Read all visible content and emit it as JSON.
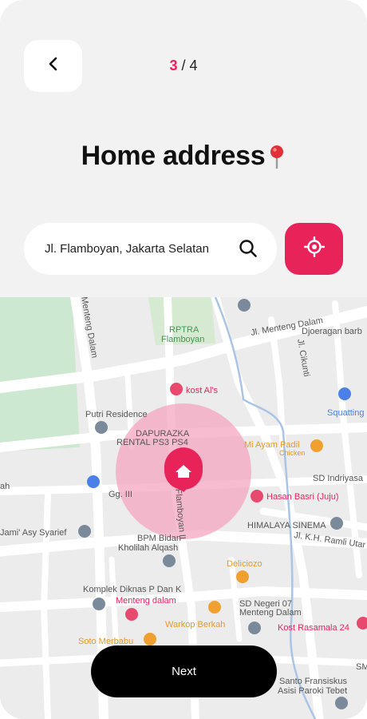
{
  "header": {
    "step_current": "3",
    "step_sep": " / ",
    "step_total": "4",
    "title": "Home address"
  },
  "search": {
    "value": "Jl. Flamboyan, Jakarta Selatan"
  },
  "map": {
    "labels": {
      "menteng_dalam_road": "Menteng Dalam",
      "rptra": "RPTRA",
      "flamboyan": "Flamboyan",
      "jl_menteng_dalam": "Jl. Menteng Dalam",
      "djoeragan": "Djoeragan barb",
      "jl_cikunti": "Jl. Cikunti",
      "kost_als": "kost Al's",
      "squatting": "Squatting",
      "putri_residence": "Putri Residence",
      "dapurazka": "DAPURAZKA",
      "rental": "RENTAL PS3 PS4",
      "mi_ayam": "Mi Ayam Padil",
      "chicken": "Chicken",
      "sd_indriyasa": "SD Indriyasa",
      "ah": "ah",
      "gg3": "Gg. III",
      "flamboyan_ii": "Flamboyan II",
      "hasan_basri": "Hasan Basri (Juju)",
      "himalaya": "HIMALAYA SINEMA",
      "jami": "Jami' Asy Syarief",
      "bpm_bidan": "BPM Bidan",
      "kholilah": "Kholilah Alqash",
      "jl_kh_ramli": "Jl. K.H. Ramli Utar",
      "deliciozo": "Deliciozo",
      "komplek": "Komplek Diknas P Dan K",
      "menteng_dalam_poi": "Menteng dalam",
      "sd_negeri": "SD Negeri 07",
      "menteng_dalam_school": "Menteng Dalam",
      "warkop": "Warkop Berkah",
      "kost_rasamala": "Kost Rasamala 24",
      "soto": "Soto Merbabu",
      "santo": "Santo Fransiskus",
      "asisi": "Asisi Paroki Tebet",
      "sm": "SM"
    }
  },
  "footer": {
    "next_label": "Next"
  },
  "colors": {
    "accent": "#e8235a",
    "button_dark": "#000000",
    "radius_fill": "#f4a6c0"
  },
  "icons": {
    "back": "chevron-left-icon",
    "search": "search-icon",
    "locate": "crosshair-icon",
    "marker": "home-marker-icon"
  }
}
